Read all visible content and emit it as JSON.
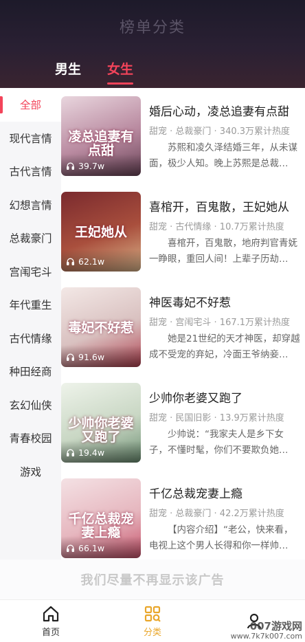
{
  "header": {
    "title": "榜单分类",
    "tabs": [
      {
        "label": "男生",
        "active": false
      },
      {
        "label": "女生",
        "active": true
      }
    ]
  },
  "sidebar": {
    "items": [
      {
        "label": "全部",
        "active": true
      },
      {
        "label": "现代言情"
      },
      {
        "label": "古代言情"
      },
      {
        "label": "幻想言情"
      },
      {
        "label": "总裁豪门"
      },
      {
        "label": "宫闱宅斗"
      },
      {
        "label": "年代重生"
      },
      {
        "label": "古代情缘"
      },
      {
        "label": "种田经商"
      },
      {
        "label": "玄幻仙侠"
      },
      {
        "label": "青春校园"
      },
      {
        "label": "游戏"
      }
    ]
  },
  "books": [
    {
      "title": "婚后心动，凌总追妻有点甜",
      "cover_title": "凌总追妻有点甜",
      "plays": "39.7w",
      "meta": "甜宠 · 总裁豪门 · 340.3万累计热度",
      "desc": "苏熙和凌久泽结婚三年，从未谋面，极少人知。晚上苏熙是总裁…",
      "cover_colors": [
        "#e9d6de",
        "#b98aa0",
        "#6a4458"
      ]
    },
    {
      "title": "喜棺开，百鬼散，王妃她从",
      "cover_title": "王妃她从",
      "plays": "62.1w",
      "meta": "甜宠 · 古代情缘 · 10.7万累计热度",
      "desc": "喜棺开，百鬼散，地府判官青妩一睁眼，重回人间！上辈子历劫…",
      "cover_colors": [
        "#7a2a2e",
        "#a94f3d",
        "#d9b48a"
      ]
    },
    {
      "title": "神医毒妃不好惹",
      "cover_title": "毒妃不好惹",
      "plays": "91.6w",
      "meta": "甜宠 · 宫闱宅斗 · 167.1万累计热度",
      "desc": "她是21世纪的天才神医，却穿越成不受宠的弃妃，冷面王爷纳妾…",
      "cover_colors": [
        "#f3e8e6",
        "#d9c1c0",
        "#b04150"
      ]
    },
    {
      "title": "少帅你老婆又跑了",
      "cover_title": "少帅你老婆又跑了",
      "plays": "19.4w",
      "meta": "甜宠 · 民国旧影 · 13.9万累计热度",
      "desc": "少帅说：“我家夫人是乡下女子，不懂时髦，你们不要欺负她…",
      "cover_colors": [
        "#eef3ea",
        "#c9d7c4",
        "#6d8f73"
      ]
    },
    {
      "title": "千亿总裁宠妻上瘾",
      "cover_title": "千亿总裁宠妻上瘾",
      "plays": "66.1w",
      "meta": "甜宠 · 总裁豪门 · 42.2万累计热度",
      "desc": "【内容介绍】“老公，快来看，电视上这个男人长得和你一样帅…",
      "cover_colors": [
        "#f4e1e4",
        "#e6b7bf",
        "#c7536b"
      ]
    }
  ],
  "ad": {
    "text": "我们尽量不再显示该广告"
  },
  "bottom_nav": [
    {
      "label": "首页",
      "icon": "home-icon",
      "active": false
    },
    {
      "label": "分类",
      "icon": "category-icon",
      "active": true
    },
    {
      "label": "",
      "icon": "profile-icon",
      "active": false
    }
  ],
  "watermark": {
    "line1": "007游戏网",
    "line2": "www.7k7k007.com"
  },
  "colors": {
    "accent": "#f3445a",
    "nav_active": "#e9a62a"
  }
}
